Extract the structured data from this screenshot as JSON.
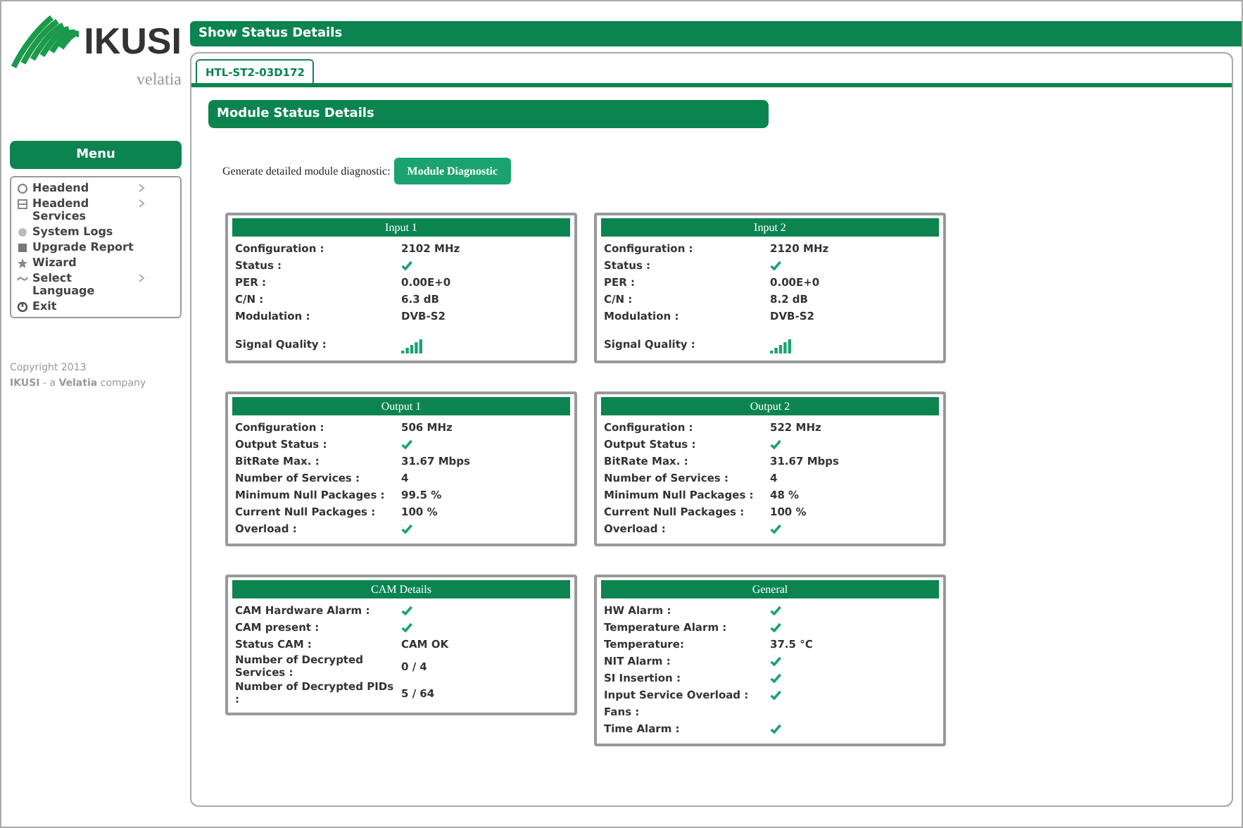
{
  "logo": {
    "brand": "IKUSI",
    "sub": "velatia"
  },
  "menu": {
    "title": "Menu",
    "items": [
      {
        "label": "Headend",
        "submenu": true
      },
      {
        "label": "Headend Services",
        "submenu": true
      },
      {
        "label": "System Logs",
        "submenu": false
      },
      {
        "label": "Upgrade Report",
        "submenu": false
      },
      {
        "label": "Wizard",
        "submenu": false
      },
      {
        "label": "Select Language",
        "submenu": true
      },
      {
        "label": "Exit",
        "submenu": false
      }
    ]
  },
  "copyright": [
    "Copyright 2013",
    "**IKUSI** - a **Velatia** company"
  ],
  "header": {
    "title": "Show Status Details"
  },
  "tabs": [
    {
      "label": "HTL-ST2-03D172",
      "selected": true
    }
  ],
  "section": {
    "title": "Module Status Details"
  },
  "diagnostic": {
    "label": "Generate detailed module diagnostic:",
    "button": "Module Diagnostic"
  },
  "cards": [
    {
      "title": "Input 1",
      "rows": [
        {
          "label": "Configuration :",
          "kind": "text",
          "value": "2102 MHz"
        },
        {
          "label": "Status :",
          "kind": "check"
        },
        {
          "label": "PER :",
          "kind": "text",
          "value": "0.00E+0"
        },
        {
          "label": "C/N :",
          "kind": "text",
          "value": "6.3 dB"
        },
        {
          "label": "Modulation :",
          "kind": "text",
          "value": "DVB-S2"
        },
        {
          "label": "Signal Quality :",
          "kind": "signal"
        }
      ]
    },
    {
      "title": "Input 2",
      "rows": [
        {
          "label": "Configuration :",
          "kind": "text",
          "value": "2120 MHz"
        },
        {
          "label": "Status :",
          "kind": "check"
        },
        {
          "label": "PER :",
          "kind": "text",
          "value": "0.00E+0"
        },
        {
          "label": "C/N :",
          "kind": "text",
          "value": "8.2 dB"
        },
        {
          "label": "Modulation :",
          "kind": "text",
          "value": "DVB-S2"
        },
        {
          "label": "Signal Quality :",
          "kind": "signal"
        }
      ]
    },
    {
      "title": "Output 1",
      "rows": [
        {
          "label": "Configuration :",
          "kind": "text",
          "value": "506 MHz"
        },
        {
          "label": "Output Status :",
          "kind": "check"
        },
        {
          "label": "BitRate Max. :",
          "kind": "text",
          "value": "31.67 Mbps"
        },
        {
          "label": "Number of Services :",
          "kind": "text",
          "value": "4"
        },
        {
          "label": "Minimum Null Packages :",
          "kind": "text",
          "value": "99.5 %"
        },
        {
          "label": "Current Null Packages :",
          "kind": "text",
          "value": "100 %"
        },
        {
          "label": "Overload :",
          "kind": "check"
        }
      ]
    },
    {
      "title": "Output 2",
      "rows": [
        {
          "label": "Configuration :",
          "kind": "text",
          "value": "522 MHz"
        },
        {
          "label": "Output Status :",
          "kind": "check"
        },
        {
          "label": "BitRate Max. :",
          "kind": "text",
          "value": "31.67 Mbps"
        },
        {
          "label": "Number of Services :",
          "kind": "text",
          "value": "4"
        },
        {
          "label": "Minimum Null Packages :",
          "kind": "text",
          "value": "48 %"
        },
        {
          "label": "Current Null Packages :",
          "kind": "text",
          "value": "100 %"
        },
        {
          "label": "Overload :",
          "kind": "check"
        }
      ]
    },
    {
      "title": "CAM Details",
      "rows": [
        {
          "label": "CAM Hardware Alarm :",
          "kind": "check"
        },
        {
          "label": "CAM present :",
          "kind": "check"
        },
        {
          "label": "Status CAM :",
          "kind": "text",
          "value": "CAM OK"
        },
        {
          "label": "Number of Decrypted Services :",
          "kind": "text",
          "value": "0 / 4"
        },
        {
          "label": "Number of Decrypted PIDs :",
          "kind": "text",
          "value": "5 / 64"
        }
      ]
    },
    {
      "title": "General",
      "rows": [
        {
          "label": "HW Alarm :",
          "kind": "check"
        },
        {
          "label": "Temperature Alarm :",
          "kind": "check"
        },
        {
          "label": "Temperature:",
          "kind": "text",
          "value": "37.5 °C"
        },
        {
          "label": "NIT Alarm :",
          "kind": "check"
        },
        {
          "label": "SI Insertion :",
          "kind": "check"
        },
        {
          "label": "Input Service Overload :",
          "kind": "check"
        },
        {
          "label": "Fans :",
          "kind": "empty"
        },
        {
          "label": "Time Alarm :",
          "kind": "check"
        }
      ]
    }
  ]
}
